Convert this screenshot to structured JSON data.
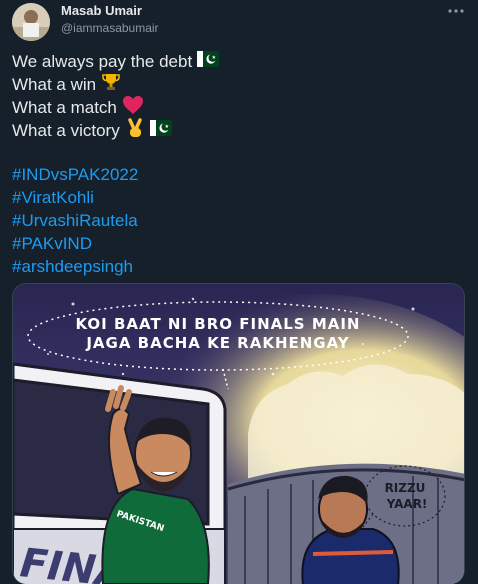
{
  "author": {
    "name": "Masab Umair",
    "handle": "@iammasabumair"
  },
  "text_lines": [
    "We always pay the debt",
    "What a win",
    "What a match",
    "What a victory"
  ],
  "emojis": {
    "line1": "pakistan-flag",
    "line2": "trophy",
    "line3": "red-heart",
    "line4": [
      "victory-hand",
      "pakistan-flag"
    ]
  },
  "hashtags": [
    "#INDvsPAK2022",
    "#ViratKohli",
    "#UrvashiRautela",
    "#PAKvIND",
    "#arshdeepsingh"
  ],
  "image": {
    "speech_left_line1": "KOI BAAT NI BRO FINALS MAIN",
    "speech_left_line2": "JAGA BACHA KE RAKHENGAY",
    "speech_right_line1": "RIZZU",
    "speech_right_line2": "YAAR!",
    "bus_text": "FINALS",
    "jersey_text": "PAKISTAN"
  },
  "colors": {
    "background": "#15202b",
    "link": "#1d9bf0",
    "text": "#e7e9ea",
    "secondary": "#8b98a5"
  }
}
